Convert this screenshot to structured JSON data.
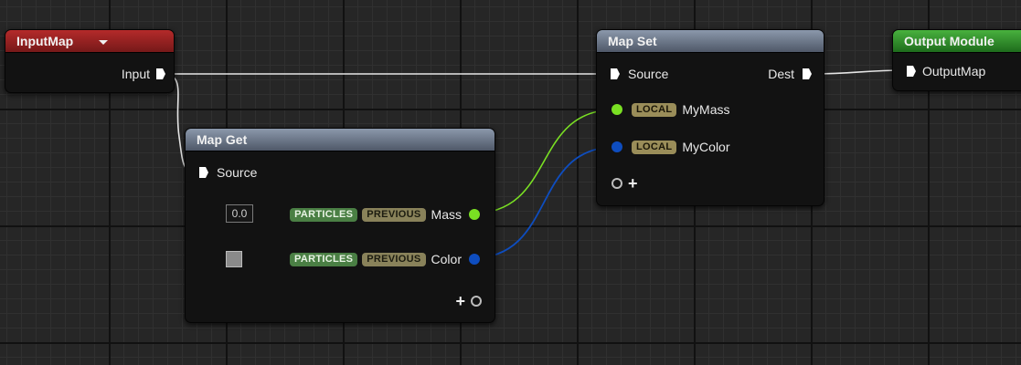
{
  "nodes": {
    "input_map": {
      "title": "InputMap",
      "dropdown_icon": "chevron-down-icon",
      "output_pin": "Input"
    },
    "map_get": {
      "title": "Map Get",
      "source_pin": "Source",
      "rows": [
        {
          "default": "0.0",
          "tag1": "PARTICLES",
          "tag2": "PREVIOUS",
          "label": "Mass",
          "pin_color": "#7ae023"
        },
        {
          "default_swatch": "#8a8a8a",
          "tag1": "PARTICLES",
          "tag2": "PREVIOUS",
          "label": "Color",
          "pin_color": "#0e4dbf"
        }
      ],
      "add_icon": "plus-icon"
    },
    "map_set": {
      "title": "Map Set",
      "source_pin": "Source",
      "dest_pin": "Dest",
      "rows": [
        {
          "tag": "LOCAL",
          "label": "MyMass",
          "pin_color": "#7ae023"
        },
        {
          "tag": "LOCAL",
          "label": "MyColor",
          "pin_color": "#0e4dbf"
        }
      ],
      "add_icon": "plus-icon"
    },
    "output_module": {
      "title": "Output Module",
      "input_pin": "OutputMap"
    }
  },
  "colors": {
    "header_red": "#a32424",
    "header_grey": "#7b8698",
    "header_green": "#3aa032",
    "mass_wire": "#7ae023",
    "color_wire": "#0e4dbf",
    "exec_wire": "#e0e0e0"
  }
}
